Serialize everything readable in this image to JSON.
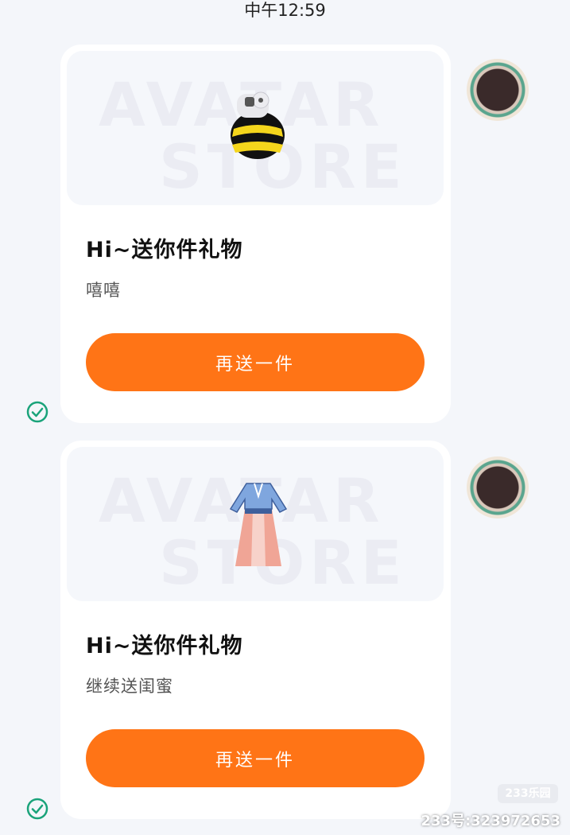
{
  "chat": {
    "timestamp": "中午12:59",
    "messages": [
      {
        "banner_watermark_line1": "AVATAR",
        "banner_watermark_line2": "STORE",
        "gift_icon": "bee-gift-icon",
        "title": "Hi~送你件礼物",
        "message": "嘻嘻",
        "button_label": "再送一件",
        "status_icon": "check-circle-icon"
      },
      {
        "banner_watermark_line1": "AVATAR",
        "banner_watermark_line2": "STORE",
        "gift_icon": "hanfu-dress-gift-icon",
        "title": "Hi~送你件礼物",
        "message": "继续送闺蜜",
        "button_label": "再送一件",
        "status_icon": "check-circle-icon"
      }
    ]
  },
  "watermark": {
    "badge": "233乐园",
    "id_text": "233号:323972653"
  },
  "colors": {
    "accent": "#ff7416",
    "check": "#1aa37a",
    "background": "#f4f6fa"
  }
}
